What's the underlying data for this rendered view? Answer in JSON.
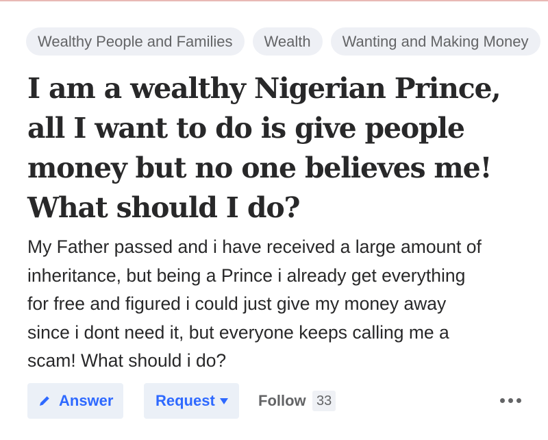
{
  "topics": [
    "Wealthy People and Families",
    "Wealth",
    "Wanting and Making Money"
  ],
  "question": {
    "title_lines": [
      "I am a wealthy Nigerian Prince,",
      "all I want to do is give people",
      "money but no one believes me!",
      "What should I do?"
    ],
    "details_lines": [
      "My Father passed and i have received a large amount of",
      "inheritance, but being a Prince i already get everything",
      "for free and figured i could just give my money away",
      "since i dont need it, but everyone keeps calling me a",
      "scam! What should i do?"
    ]
  },
  "actions": {
    "answer_label": "Answer",
    "answer_icon": "pencil-icon",
    "request_label": "Request",
    "request_icon": "caret-down-icon",
    "follow_label": "Follow",
    "follow_count": "33",
    "more_icon": "more-options-icon"
  },
  "colors": {
    "accent": "#2e69ff",
    "button_bg": "#ebf0f7",
    "topic_bg": "#eef0f5",
    "text": "#282829",
    "muted": "#636466"
  }
}
